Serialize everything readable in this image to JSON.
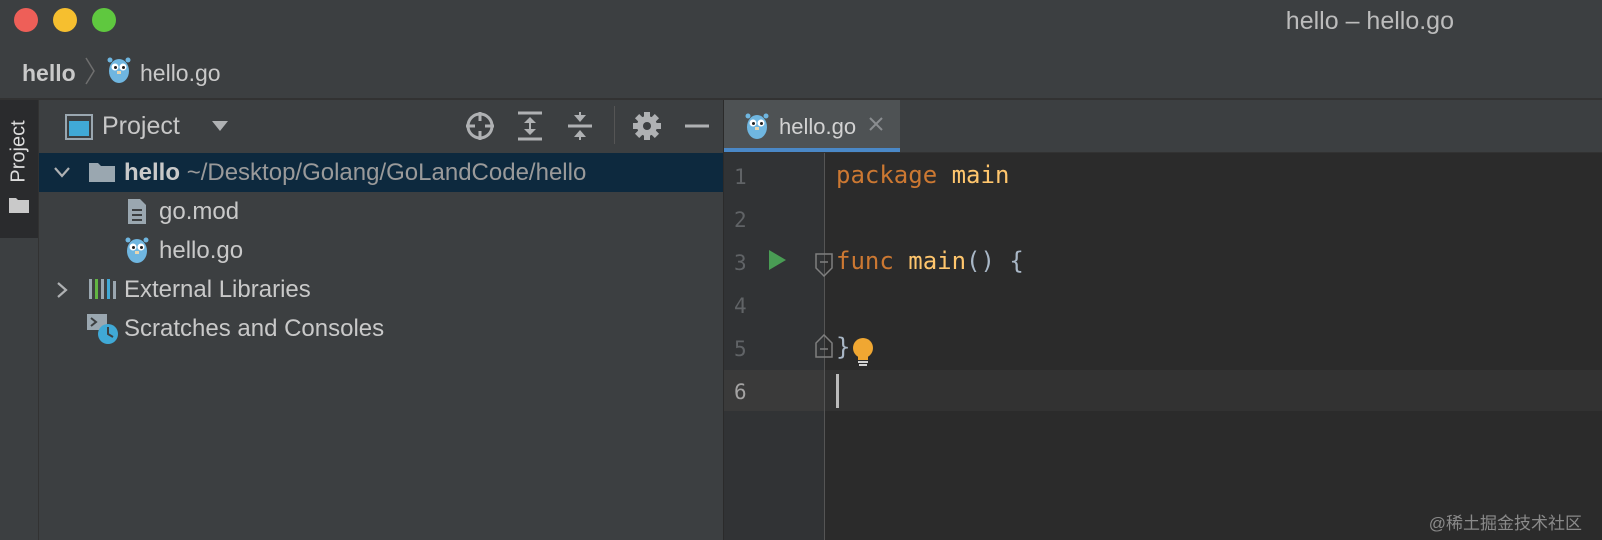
{
  "window": {
    "title": "hello – hello.go"
  },
  "navbar": {
    "root": "hello",
    "file": "hello.go"
  },
  "side_strip": {
    "tab_label": "Project"
  },
  "project_panel": {
    "title": "Project",
    "toolbar": [
      "locate-icon",
      "expand-all-icon",
      "collapse-all-icon",
      "gear-icon",
      "minimize-icon"
    ],
    "tree": {
      "root": {
        "name": "hello",
        "path": "~/Desktop/Golang/GoLandCode/hello"
      },
      "children": [
        {
          "name": "go.mod",
          "icon": "file-icon"
        },
        {
          "name": "hello.go",
          "icon": "gopher-icon"
        }
      ],
      "external_libraries": "External Libraries",
      "scratches": "Scratches and Consoles"
    }
  },
  "editor": {
    "tab": {
      "label": "hello.go"
    },
    "line_numbers": [
      "1",
      "2",
      "3",
      "4",
      "5",
      "6"
    ],
    "lines": {
      "l1_kw": "package",
      "l1_name": "main",
      "l3_kw": "func",
      "l3_name": "main",
      "l3_rest": "() {",
      "l5": "}"
    }
  },
  "colors": {
    "keyword": "#cc7832",
    "function": "#ffc66d",
    "text": "#a9b7c6",
    "selection": "#0d293e",
    "tab_underline": "#4a88c7"
  },
  "watermark": "@稀土掘金技术社区"
}
